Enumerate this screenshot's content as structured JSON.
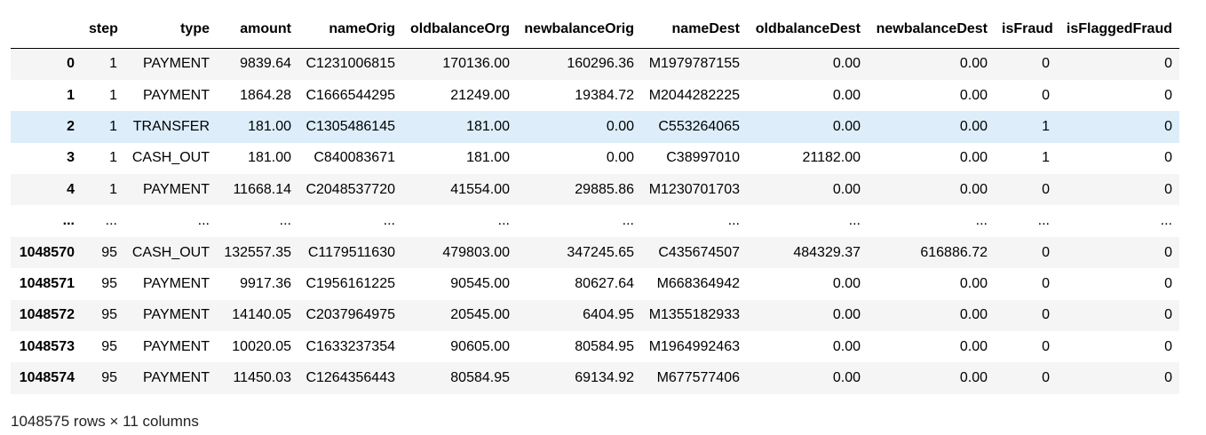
{
  "table": {
    "index_header": "",
    "columns": [
      "step",
      "type",
      "amount",
      "nameOrig",
      "oldbalanceOrg",
      "newbalanceOrig",
      "nameDest",
      "oldbalanceDest",
      "newbalanceDest",
      "isFraud",
      "isFlaggedFraud"
    ],
    "rows": [
      {
        "index": "0",
        "cells": [
          "1",
          "PAYMENT",
          "9839.64",
          "C1231006815",
          "170136.00",
          "160296.36",
          "M1979787155",
          "0.00",
          "0.00",
          "0",
          "0"
        ]
      },
      {
        "index": "1",
        "cells": [
          "1",
          "PAYMENT",
          "1864.28",
          "C1666544295",
          "21249.00",
          "19384.72",
          "M2044282225",
          "0.00",
          "0.00",
          "0",
          "0"
        ]
      },
      {
        "index": "2",
        "cells": [
          "1",
          "TRANSFER",
          "181.00",
          "C1305486145",
          "181.00",
          "0.00",
          "C553264065",
          "0.00",
          "0.00",
          "1",
          "0"
        ],
        "highlighted": true
      },
      {
        "index": "3",
        "cells": [
          "1",
          "CASH_OUT",
          "181.00",
          "C840083671",
          "181.00",
          "0.00",
          "C38997010",
          "21182.00",
          "0.00",
          "1",
          "0"
        ]
      },
      {
        "index": "4",
        "cells": [
          "1",
          "PAYMENT",
          "11668.14",
          "C2048537720",
          "41554.00",
          "29885.86",
          "M1230701703",
          "0.00",
          "0.00",
          "0",
          "0"
        ]
      },
      {
        "index": "...",
        "cells": [
          "...",
          "...",
          "...",
          "...",
          "...",
          "...",
          "...",
          "...",
          "...",
          "...",
          "..."
        ]
      },
      {
        "index": "1048570",
        "cells": [
          "95",
          "CASH_OUT",
          "132557.35",
          "C1179511630",
          "479803.00",
          "347245.65",
          "C435674507",
          "484329.37",
          "616886.72",
          "0",
          "0"
        ]
      },
      {
        "index": "1048571",
        "cells": [
          "95",
          "PAYMENT",
          "9917.36",
          "C1956161225",
          "90545.00",
          "80627.64",
          "M668364942",
          "0.00",
          "0.00",
          "0",
          "0"
        ]
      },
      {
        "index": "1048572",
        "cells": [
          "95",
          "PAYMENT",
          "14140.05",
          "C2037964975",
          "20545.00",
          "6404.95",
          "M1355182933",
          "0.00",
          "0.00",
          "0",
          "0"
        ]
      },
      {
        "index": "1048573",
        "cells": [
          "95",
          "PAYMENT",
          "10020.05",
          "C1633237354",
          "90605.00",
          "80584.95",
          "M1964992463",
          "0.00",
          "0.00",
          "0",
          "0"
        ]
      },
      {
        "index": "1048574",
        "cells": [
          "95",
          "PAYMENT",
          "11450.03",
          "C1264356443",
          "80584.95",
          "69134.92",
          "M677577406",
          "0.00",
          "0.00",
          "0",
          "0"
        ]
      }
    ]
  },
  "shape_text": "1048575 rows × 11 columns",
  "colors": {
    "row_stripe": "#f5f5f5",
    "row_highlight": "#ddeefa",
    "header_rule": "#000000"
  }
}
